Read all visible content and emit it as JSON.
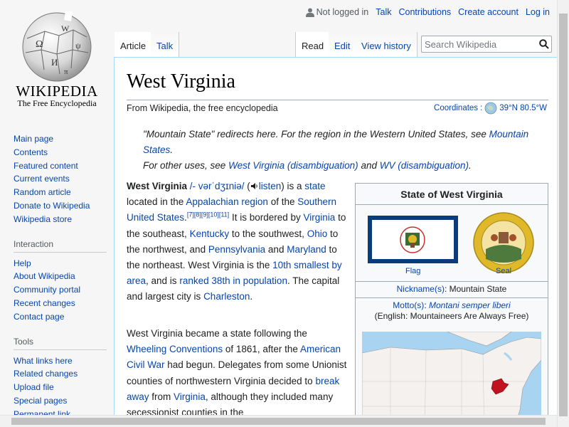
{
  "logo": {
    "wordmark": "WIKIPEDIA",
    "tagline": "The Free Encyclopedia"
  },
  "personal": {
    "not_logged_in": "Not logged in",
    "talk": "Talk",
    "contributions": "Contributions",
    "create_account": "Create account",
    "login": "Log in"
  },
  "tabs": {
    "article": "Article",
    "talk": "Talk",
    "read": "Read",
    "edit": "Edit",
    "history": "View history"
  },
  "search": {
    "placeholder": "Search Wikipedia"
  },
  "sidebar": {
    "navigation": [
      "Main page",
      "Contents",
      "Featured content",
      "Current events",
      "Random article",
      "Donate to Wikipedia",
      "Wikipedia store"
    ],
    "interaction_title": "Interaction",
    "interaction": [
      "Help",
      "About Wikipedia",
      "Community portal",
      "Recent changes",
      "Contact page"
    ],
    "tools_title": "Tools",
    "tools": [
      "What links here",
      "Related changes",
      "Upload file",
      "Special pages",
      "Permanent link"
    ]
  },
  "article": {
    "title": "West Virginia",
    "site_sub": "From Wikipedia, the free encyclopedia",
    "coords_label": "Coordinates",
    "coords_value": "39°N 80.5°W",
    "hatnote1_text": "\"Mountain State\" redirects here. For the region in the Western United States, see",
    "hatnote1_link": "Mountain States",
    "hatnote2_text": "For other uses, see",
    "hatnote2_link1": "West Virginia (disambiguation)",
    "hatnote2_and": "and",
    "hatnote2_link2": "WV (disambiguation)",
    "p1": {
      "bold": "West Virginia",
      "ipa": "/- vərˈdʒɪniə/",
      "listen": "listen",
      "t1": "is a",
      "state": "state",
      "t2": "located in the",
      "appalachian": "Appalachian region",
      "t3": "of the",
      "southern": "Southern United States",
      "refs": "[7][8][9][10][11]",
      "t4": "It is bordered by",
      "virginia": "Virginia",
      "t5": "to the southeast,",
      "kentucky": "Kentucky",
      "t6": "to the southwest,",
      "ohio": "Ohio",
      "t7": "to the northwest, and",
      "pennsylvania": "Pennsylvania",
      "t8": "and",
      "maryland": "Maryland",
      "t9": "to the northeast. West Virginia is the",
      "smallest": "10th smallest by area",
      "t10": ", and is",
      "ranked": "ranked 38th in population",
      "t11": ". The capital and largest city is",
      "charleston": "Charleston",
      "t12": "."
    },
    "p2": {
      "t1": "West Virginia became a state following the",
      "wheeling": "Wheeling Conventions",
      "t2": "of 1861, after the",
      "civil_war": "American Civil War",
      "t3": "had begun. Delegates from some Unionist counties of northwestern Virginia decided to",
      "break": "break away",
      "t4": "from",
      "virginia": "Virginia",
      "t5": ", although they included many secessionist counties in the"
    }
  },
  "infobox": {
    "title": "State of West Virginia",
    "flag_caption": "Flag",
    "seal_caption": "Seal",
    "nickname_label": "Nickname(s)",
    "nickname_value": "Mountain State",
    "motto_label": "Motto(s)",
    "motto_value": "Montani semper liberi",
    "motto_translation": "(English: Mountaineers Are Always Free)"
  },
  "colors": {
    "link": "#0645ad",
    "flag_border": "#0a3b7a",
    "seal_gold": "#e0b92a",
    "map_land": "#f4f1ee",
    "map_water": "#a8d4f2",
    "map_highlight": "#c1121f"
  }
}
